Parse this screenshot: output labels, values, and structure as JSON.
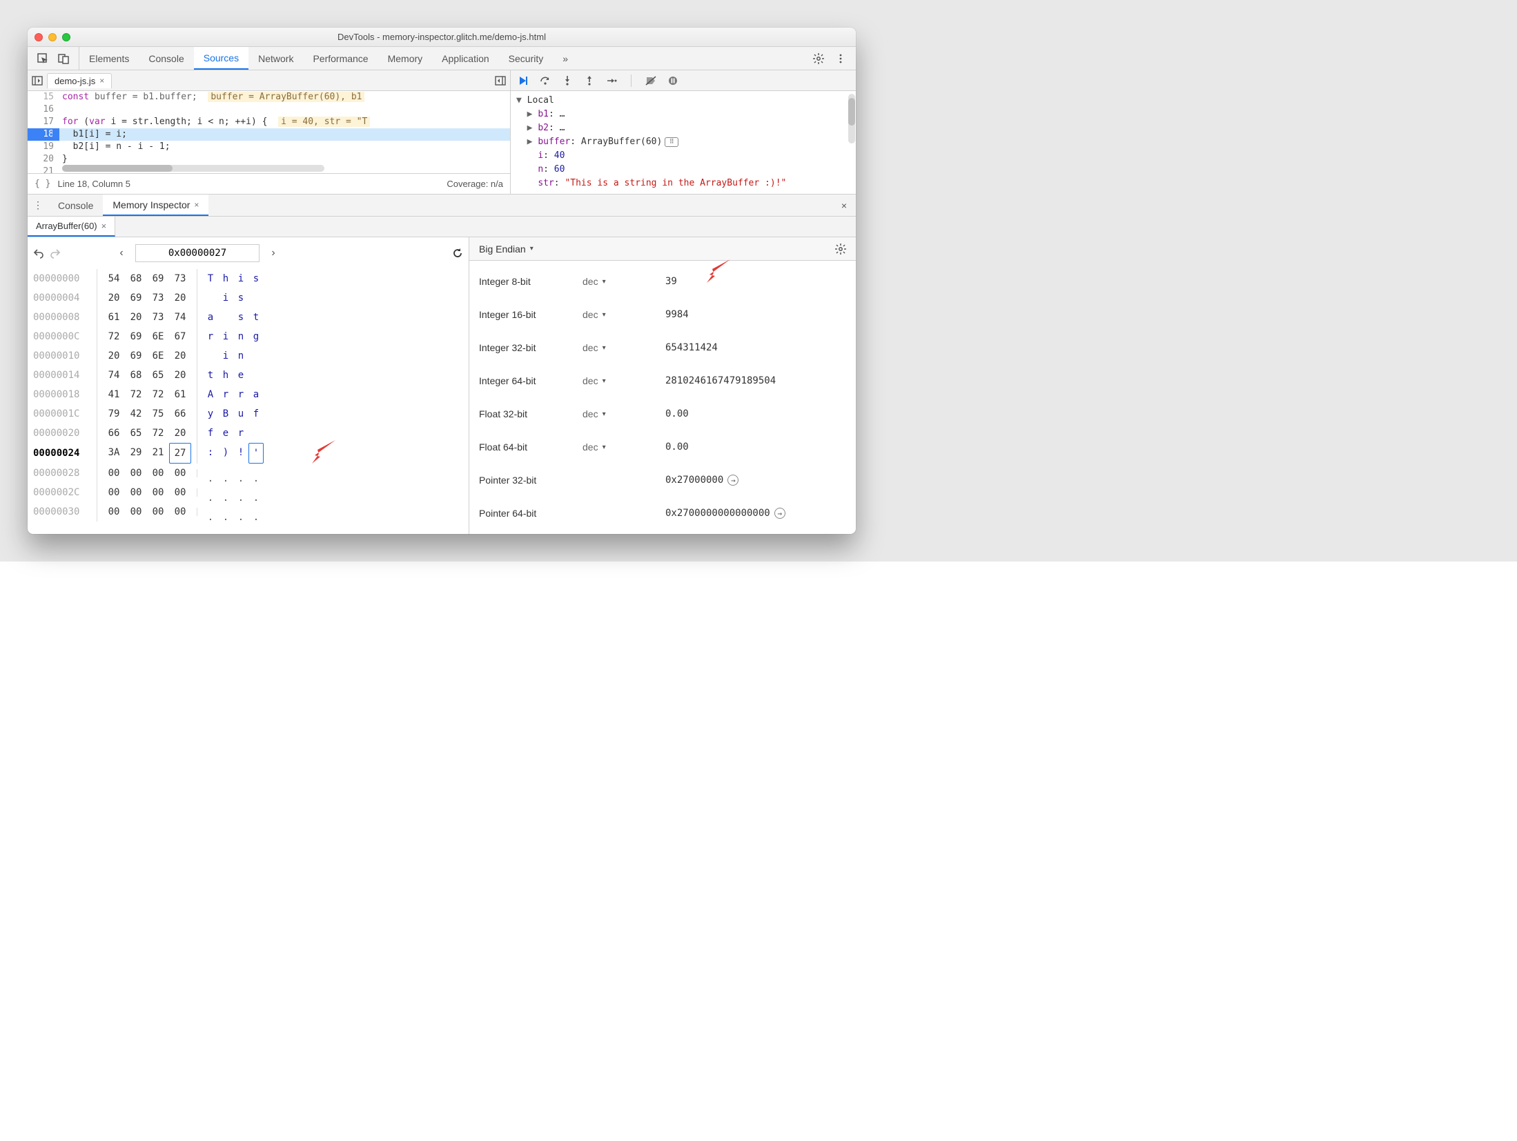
{
  "window_title": "DevTools - memory-inspector.glitch.me/demo-js.html",
  "main_tabs": [
    "Elements",
    "Console",
    "Sources",
    "Network",
    "Performance",
    "Memory",
    "Application",
    "Security"
  ],
  "main_active": "Sources",
  "file_tab": "demo-js.js",
  "code": {
    "lines": [
      {
        "n": 15,
        "cutoff": true,
        "html": "<span class='kw'>const</span> buffer = b1.buffer;  <span class='inline-eval'>buffer = ArrayBuffer(60), b1</span>"
      },
      {
        "n": 16,
        "html": ""
      },
      {
        "n": 17,
        "html": "<span class='kw'>for</span> (<span class='kw'>var</span> i = str.length; i &lt; n; ++i) {  <span class='inline-eval'>i = 40, str = \"T</span>"
      },
      {
        "n": 18,
        "hl": true,
        "html": "  b1[i] = i;"
      },
      {
        "n": 19,
        "html": "  b2[i] = n - i - 1;"
      },
      {
        "n": 20,
        "html": "}"
      },
      {
        "n": 21,
        "html": ""
      }
    ]
  },
  "status": {
    "braces": "{ }",
    "loc": "Line 18, Column 5",
    "coverage": "Coverage: n/a"
  },
  "scope": {
    "header": "Local",
    "rows": [
      {
        "k": "b1",
        "v": "…",
        "tri": true
      },
      {
        "k": "b2",
        "v": "…",
        "tri": true
      },
      {
        "k": "buffer",
        "v": "ArrayBuffer(60)",
        "tri": true,
        "badge": true
      },
      {
        "k": "i",
        "v": "40",
        "num": true
      },
      {
        "k": "n",
        "v": "60",
        "num": true
      },
      {
        "k": "str",
        "v": "\"This is a string in the ArrayBuffer :)!\"",
        "str": true
      }
    ]
  },
  "drawer": {
    "tabs": [
      "Console",
      "Memory Inspector"
    ],
    "active": "Memory Inspector",
    "inner_tab": "ArrayBuffer(60)"
  },
  "memory": {
    "address": "0x00000027",
    "selected_row_index": 9,
    "selected_col_index": 3,
    "rows": [
      {
        "addr": "00000000",
        "bytes": [
          "54",
          "68",
          "69",
          "73"
        ],
        "ascii": [
          "T",
          "h",
          "i",
          "s"
        ]
      },
      {
        "addr": "00000004",
        "bytes": [
          "20",
          "69",
          "73",
          "20"
        ],
        "ascii": [
          " ",
          "i",
          "s",
          " "
        ]
      },
      {
        "addr": "00000008",
        "bytes": [
          "61",
          "20",
          "73",
          "74"
        ],
        "ascii": [
          "a",
          " ",
          "s",
          "t"
        ]
      },
      {
        "addr": "0000000C",
        "bytes": [
          "72",
          "69",
          "6E",
          "67"
        ],
        "ascii": [
          "r",
          "i",
          "n",
          "g"
        ]
      },
      {
        "addr": "00000010",
        "bytes": [
          "20",
          "69",
          "6E",
          "20"
        ],
        "ascii": [
          " ",
          "i",
          "n",
          " "
        ]
      },
      {
        "addr": "00000014",
        "bytes": [
          "74",
          "68",
          "65",
          "20"
        ],
        "ascii": [
          "t",
          "h",
          "e",
          " "
        ]
      },
      {
        "addr": "00000018",
        "bytes": [
          "41",
          "72",
          "72",
          "61"
        ],
        "ascii": [
          "A",
          "r",
          "r",
          "a"
        ]
      },
      {
        "addr": "0000001C",
        "bytes": [
          "79",
          "42",
          "75",
          "66"
        ],
        "ascii": [
          "y",
          "B",
          "u",
          "f"
        ]
      },
      {
        "addr": "00000020",
        "bytes": [
          "66",
          "65",
          "72",
          "20"
        ],
        "ascii": [
          "f",
          "e",
          "r",
          " "
        ]
      },
      {
        "addr": "00000024",
        "bytes": [
          "3A",
          "29",
          "21",
          "27"
        ],
        "ascii": [
          ":",
          ")",
          "!",
          "'"
        ]
      },
      {
        "addr": "00000028",
        "bytes": [
          "00",
          "00",
          "00",
          "00"
        ],
        "ascii": [
          ".",
          ".",
          ".",
          "."
        ]
      },
      {
        "addr": "0000002C",
        "bytes": [
          "00",
          "00",
          "00",
          "00"
        ],
        "ascii": [
          ".",
          ".",
          ".",
          "."
        ]
      },
      {
        "addr": "00000030",
        "bytes": [
          "00",
          "00",
          "00",
          "00"
        ],
        "ascii": [
          ".",
          ".",
          ".",
          "."
        ]
      }
    ]
  },
  "values": {
    "endian": "Big Endian",
    "rows": [
      {
        "label": "Integer 8-bit",
        "fmt": "dec",
        "val": "39"
      },
      {
        "label": "Integer 16-bit",
        "fmt": "dec",
        "val": "9984"
      },
      {
        "label": "Integer 32-bit",
        "fmt": "dec",
        "val": "654311424"
      },
      {
        "label": "Integer 64-bit",
        "fmt": "dec",
        "val": "2810246167479189504"
      },
      {
        "label": "Float 32-bit",
        "fmt": "dec",
        "val": "0.00"
      },
      {
        "label": "Float 64-bit",
        "fmt": "dec",
        "val": "0.00"
      },
      {
        "label": "Pointer 32-bit",
        "fmt": "",
        "val": "0x27000000",
        "ptr": true
      },
      {
        "label": "Pointer 64-bit",
        "fmt": "",
        "val": "0x2700000000000000",
        "ptr": true
      }
    ]
  }
}
